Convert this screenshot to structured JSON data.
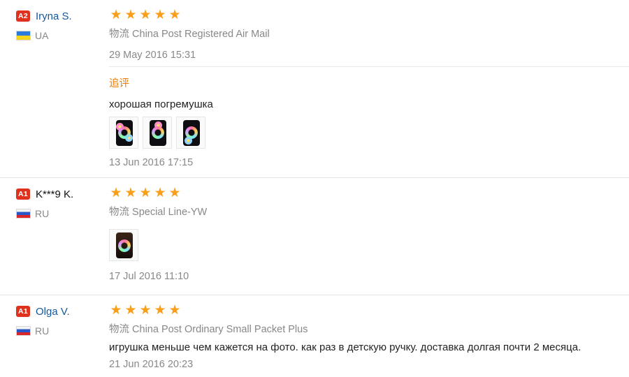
{
  "reviews": [
    {
      "badge": "A2",
      "name": "Iryna S.",
      "country": "UA",
      "stars": 5,
      "shipping": "物流 China Post Registered Air Mail",
      "date": "29 May 2016 15:31",
      "followup_label": "追评",
      "followup_text": "хорошая погремушка",
      "followup_date": "13 Jun 2016 17:15",
      "photos": 3
    },
    {
      "badge": "A1",
      "name": "K***9 K.",
      "country": "RU",
      "stars": 5,
      "shipping": "物流 Special Line-YW",
      "date": "17 Jul 2016 11:10",
      "photos": 1
    },
    {
      "badge": "A1",
      "name": "Olga V.",
      "country": "RU",
      "stars": 5,
      "shipping": "物流 China Post Ordinary Small Packet Plus",
      "text": "игрушка меньше чем кажется на фото. как раз в детскую ручку. доставка долгая почти 2 месяца.",
      "date": "21 Jun 2016 20:23"
    }
  ],
  "icons": {
    "star": "star-icon",
    "flag_ua": "ua-flag-icon",
    "flag_ru": "ru-flag-icon"
  },
  "colors": {
    "star": "#f89e19",
    "badge": "#e0301e",
    "link": "#15589b",
    "followup": "#f07b00"
  }
}
